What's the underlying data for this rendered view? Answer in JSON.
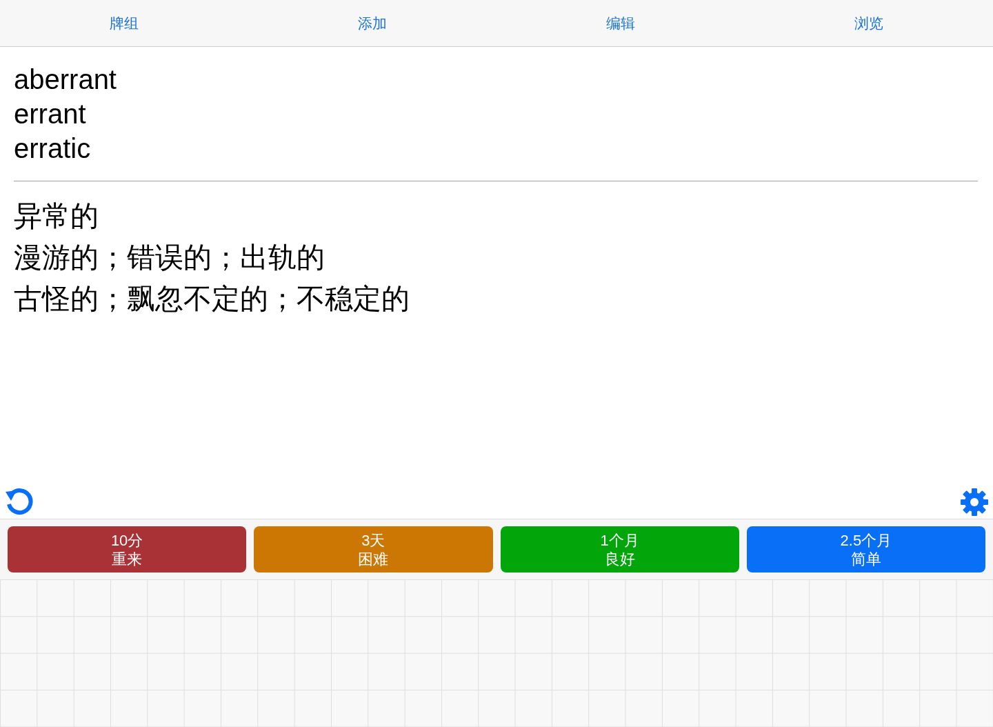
{
  "tabs": [
    {
      "label": "牌组"
    },
    {
      "label": "添加"
    },
    {
      "label": "编辑"
    },
    {
      "label": "浏览"
    }
  ],
  "card": {
    "front": [
      "aberrant",
      "errant",
      "erratic"
    ],
    "back": [
      "异常的",
      "漫游的；错误的；出轨的",
      "古怪的；飘忽不定的；不稳定的"
    ]
  },
  "answer_buttons": [
    {
      "interval": "10分",
      "label": "重来",
      "color": "#a83236"
    },
    {
      "interval": "3天",
      "label": "困难",
      "color": "#cc7604"
    },
    {
      "interval": "1个月",
      "label": "良好",
      "color": "#03a60a"
    },
    {
      "interval": "2.5个月",
      "label": "简单",
      "color": "#0a6ff7"
    }
  ]
}
